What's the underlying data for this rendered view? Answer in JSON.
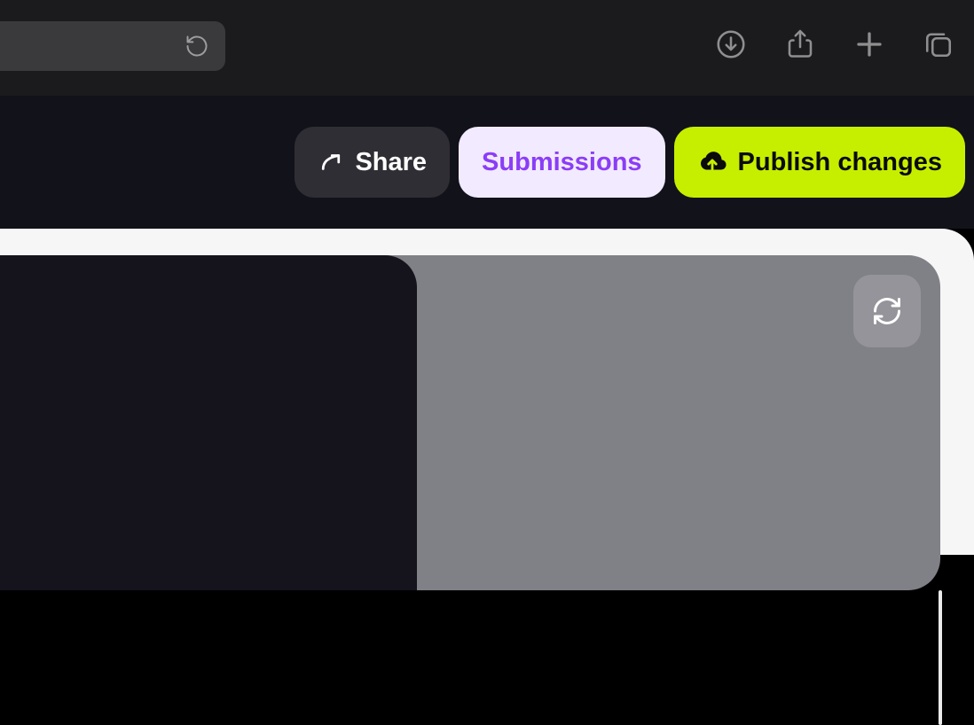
{
  "toolbar": {
    "share_label": "Share",
    "submissions_label": "Submissions",
    "publish_label": "Publish changes"
  }
}
